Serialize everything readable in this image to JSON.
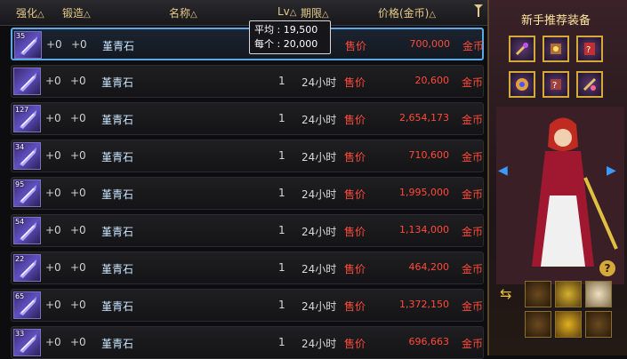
{
  "columns": {
    "enhance": "强化",
    "forge": "锻造",
    "name": "名称",
    "lv": "Lv",
    "duration": "期限",
    "price": "价格(金币)",
    "sort_triangle": "△"
  },
  "tooltip": {
    "avg_label": "平均 :",
    "avg_value": "19,500",
    "each_label": "每个 :",
    "each_value": "20,000"
  },
  "rows": [
    {
      "qty": "35",
      "enhance": "+0",
      "forge": "+0",
      "name": "堇青石",
      "lv": "",
      "duration": "",
      "sell": "售价",
      "price": "700,000",
      "currency": "金币"
    },
    {
      "qty": "",
      "enhance": "+0",
      "forge": "+0",
      "name": "堇青石",
      "lv": "1",
      "duration": "24小时",
      "sell": "售价",
      "price": "20,600",
      "currency": "金币"
    },
    {
      "qty": "127",
      "enhance": "+0",
      "forge": "+0",
      "name": "堇青石",
      "lv": "1",
      "duration": "24小时",
      "sell": "售价",
      "price": "2,654,173",
      "currency": "金币"
    },
    {
      "qty": "34",
      "enhance": "+0",
      "forge": "+0",
      "name": "堇青石",
      "lv": "1",
      "duration": "24小时",
      "sell": "售价",
      "price": "710,600",
      "currency": "金币"
    },
    {
      "qty": "95",
      "enhance": "+0",
      "forge": "+0",
      "name": "堇青石",
      "lv": "1",
      "duration": "24小时",
      "sell": "售价",
      "price": "1,995,000",
      "currency": "金币"
    },
    {
      "qty": "54",
      "enhance": "+0",
      "forge": "+0",
      "name": "堇青石",
      "lv": "1",
      "duration": "24小时",
      "sell": "售价",
      "price": "1,134,000",
      "currency": "金币"
    },
    {
      "qty": "22",
      "enhance": "+0",
      "forge": "+0",
      "name": "堇青石",
      "lv": "1",
      "duration": "24小时",
      "sell": "售价",
      "price": "464,200",
      "currency": "金币"
    },
    {
      "qty": "65",
      "enhance": "+0",
      "forge": "+0",
      "name": "堇青石",
      "lv": "1",
      "duration": "24小时",
      "sell": "售价",
      "price": "1,372,150",
      "currency": "金币"
    },
    {
      "qty": "33",
      "enhance": "+0",
      "forge": "+0",
      "name": "堇青石",
      "lv": "1",
      "duration": "24小时",
      "sell": "售价",
      "price": "696,663",
      "currency": "金币"
    }
  ],
  "right_panel": {
    "title": "新手推荐装备",
    "help": "?",
    "icons": [
      "prev-arrow-icon",
      "next-arrow-icon",
      "swap-icon"
    ]
  },
  "colors": {
    "accent_gold": "#e6c98a",
    "price_red": "#ff4a3a",
    "selected_border": "#5aa8e8"
  }
}
